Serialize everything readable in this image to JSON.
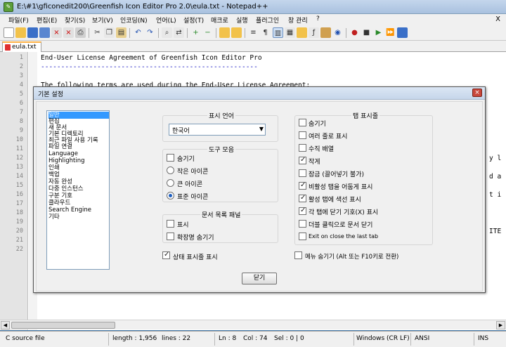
{
  "window": {
    "title": "E:\\#1\\gficonedit200\\Greenfish Icon Editor Pro 2.0\\eula.txt - Notepad++"
  },
  "menu": {
    "items": [
      "파일(F)",
      "편집(E)",
      "찾기(S)",
      "보기(V)",
      "인코딩(N)",
      "언어(L)",
      "설정(T)",
      "매크로",
      "실행",
      "플러그인",
      "창 관리",
      "?"
    ],
    "close": "X"
  },
  "tab": {
    "label": "eula.txt"
  },
  "editor": {
    "line_numbers": [
      "1",
      "2",
      "3",
      "4",
      "5",
      "6",
      "7",
      "8",
      "9",
      "10",
      "11",
      "12",
      "13",
      "14",
      "15",
      "16",
      "17",
      "18",
      "19",
      "20",
      "21",
      "22"
    ],
    "line1": "End-User License Agreement of Greenfish Icon Editor Pro",
    "line2": "------------------------------------------------------",
    "line4": "The following terms are used during the End-User License Agreement:",
    "frag_13": "y l",
    "frag_14": "d a",
    "frag_16": "t i",
    "frag_20": "ITE"
  },
  "status": {
    "type": "C source file",
    "length": "length : 1,956",
    "lines": "lines : 22",
    "ln": "Ln : 8",
    "col": "Col : 74",
    "sel": "Sel : 0 | 0",
    "eol": "Windows (CR LF)",
    "enc": "ANSI",
    "ins": "INS"
  },
  "dialog": {
    "title": "기본 설정",
    "categories": [
      "일반",
      "편집",
      "새 문서",
      "기본 디렉토리",
      "최근 파일 사용 기록",
      "파일 연결",
      "Language",
      "Highlighting",
      "인쇄",
      "백업",
      "자동 완성",
      "다중 인스턴스",
      "구분 기호",
      "클라우드",
      "Search Engine",
      "기타"
    ],
    "lang_group": {
      "title": "표시 언어",
      "value": "한국어"
    },
    "toolbar_group": {
      "title": "도구 모음",
      "hide": "숨기기",
      "small": "작은 아이콘",
      "big": "큰 아이콘",
      "std": "표준 아이콘"
    },
    "doclist_group": {
      "title": "문서 목록 패널",
      "show": "표시",
      "hide_ext": "확장명 숨기기"
    },
    "statusbar": "상태 표시줄 표시",
    "tabbar_group": {
      "title": "탭 표시줄",
      "options": [
        "숨기기",
        "여러 줄로 표시",
        "수직 배열",
        "작게",
        "잠금 (끌어넣기 불가)",
        "비활성 탭을 어둡게 표시",
        "활성 탭에 색선 표시",
        "각 탭에 닫기 기호(X) 표시",
        "더블 클릭으로 문서 닫기",
        "Exit on close the last tab"
      ]
    },
    "hide_menu": "메뉴 숨기기 (Alt 또는 F10키로 전환)",
    "close_button": "닫기"
  }
}
